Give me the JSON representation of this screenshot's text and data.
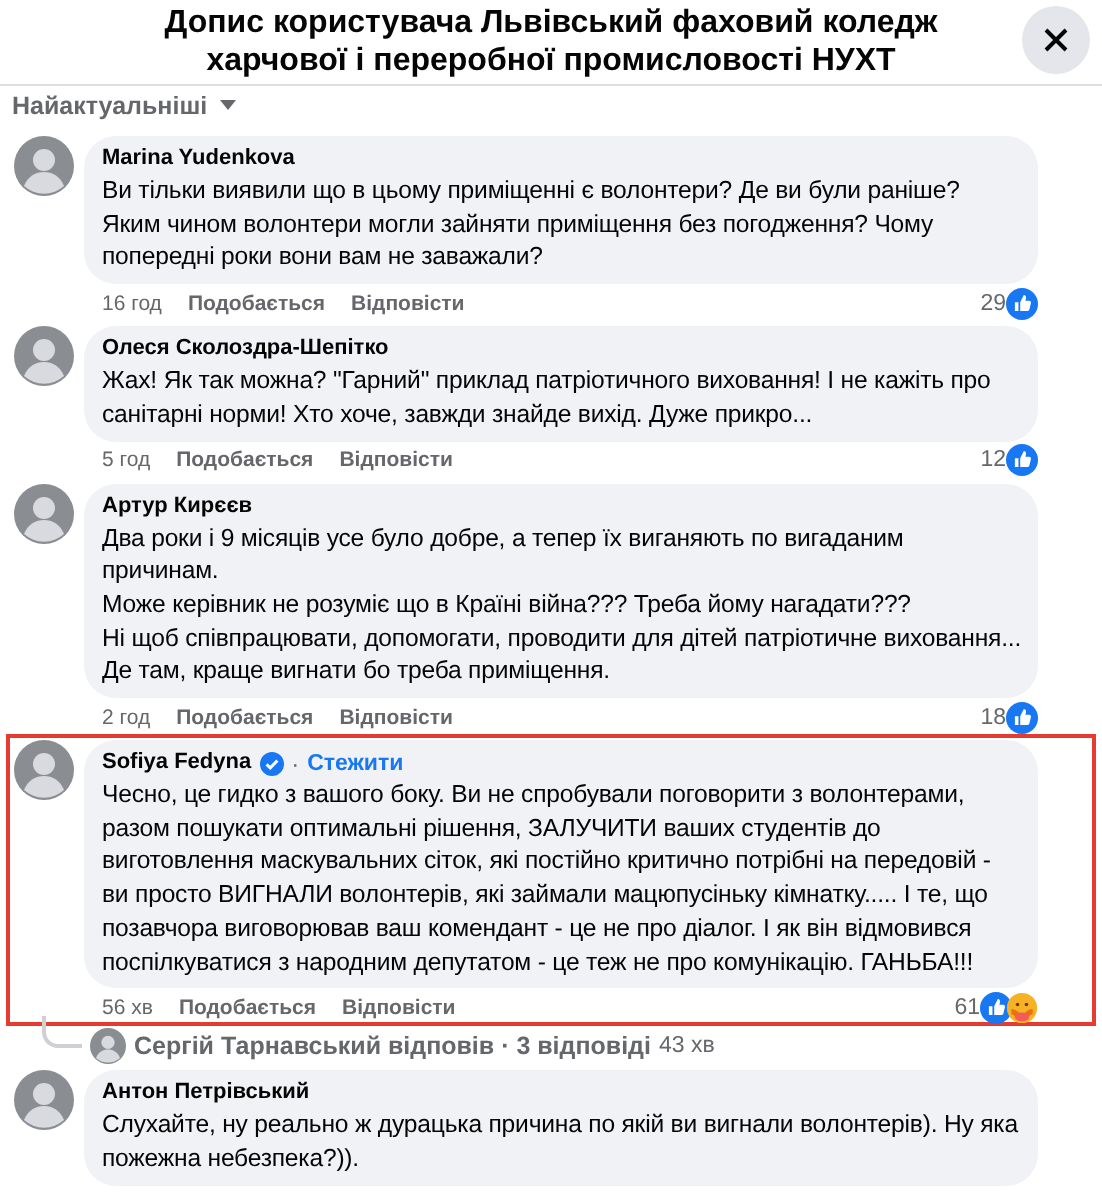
{
  "dialog": {
    "title": "Допис користувача Львівський фаховий коледж харчової і переробної промисловості НУХТ"
  },
  "sort": {
    "label": "Найактуальніші"
  },
  "comments": [
    {
      "author": "Marina Yudenkova",
      "verified": false,
      "highlighted": false,
      "text": "Ви тільки виявили що в цьому приміщенні є волонтери? Де ви були раніше? Яким чином волонтери могли зайняти приміщення без погодження? Чому попередні роки вони вам не заважали?",
      "time": "16 год",
      "like": "Подобається",
      "reply": "Відповісти",
      "count": "29",
      "reactions": [
        {
          "kind": "like"
        }
      ]
    },
    {
      "author": "Олеся Сколоздра-Шепітко",
      "verified": false,
      "highlighted": false,
      "text": "Жах! Як так можна? \"Гарний\" приклад патріотичного виховання! І не кажіть про санітарні норми! Хто хоче, завжди знайде вихід. Дуже прикро...",
      "time": "5 год",
      "like": "Подобається",
      "reply": "Відповісти",
      "count": "12",
      "reactions": [
        {
          "kind": "like"
        }
      ]
    },
    {
      "author": "Артур Кирєєв",
      "verified": false,
      "highlighted": false,
      "text": "Два роки і 9 місяців усе було добре, а тепер їх виганяють по вигаданим причинам.\nМоже керівник не розуміє що в Країні війна??? Треба йому нагадати???\nНі щоб співпрацювати, допомогати, проводити для дітей патріотичне виховання... Де там, краще вигнати бо треба приміщення.",
      "time": "2 год",
      "like": "Подобається",
      "reply": "Відповісти",
      "count": "18",
      "reactions": [
        {
          "kind": "like"
        }
      ]
    },
    {
      "author": "Sofiya Fedyna",
      "verified": true,
      "separator": "·",
      "follow": "Стежити",
      "highlighted": true,
      "text": "Чесно, це гидко з вашого боку. Ви не спробували поговорити з волонтерами, разом пошукати оптимальні рішення, ЗАЛУЧИТИ ваших студентів до виготовлення маскувальних сіток, які постійно критично потрібні на передовій - ви просто ВИГНАЛИ волонтерів, які займали мацюпусіньку кімнатку..... І те, що позавчора виговорював ваш комендант - це не про діалог. І як він відмовився поспілкуватися з народним депутатом - це теж не про комунікацію. ГАНЬБА!!!",
      "time": "56 хв",
      "like": "Подобається",
      "reply": "Відповісти",
      "count": "61",
      "reactions": [
        {
          "kind": "like"
        },
        {
          "kind": "care"
        }
      ],
      "replies": {
        "label": "Сергій Тарнавський відповів · 3 відповіді",
        "time": "43 хв"
      }
    },
    {
      "author": "Антон Петрівський",
      "verified": false,
      "highlighted": false,
      "text": "Слухайте, ну реально ж дурацька причина по якій ви вигнали волонтерів). Ну яка пожежна небезпека?))."
    }
  ]
}
